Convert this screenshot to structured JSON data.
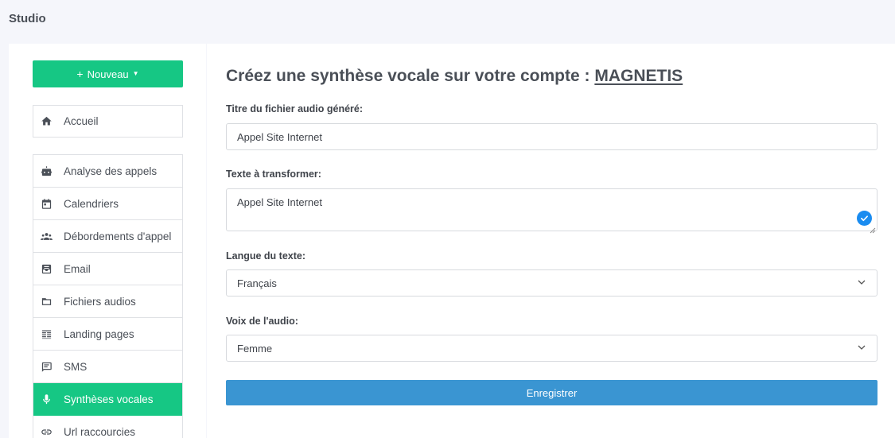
{
  "app": {
    "title": "Studio"
  },
  "sidebar": {
    "new_button": {
      "label": "Nouveau"
    },
    "home": {
      "label": "Accueil",
      "icon": "home-icon"
    },
    "items": [
      {
        "label": "Analyse des appels",
        "icon": "robot-icon",
        "active": false
      },
      {
        "label": "Calendriers",
        "icon": "calendar-icon",
        "active": false
      },
      {
        "label": "Débordements d'appel",
        "icon": "group-icon",
        "active": false
      },
      {
        "label": "Email",
        "icon": "email-icon",
        "active": false
      },
      {
        "label": "Fichiers audios",
        "icon": "folder-icon",
        "active": false
      },
      {
        "label": "Landing pages",
        "icon": "landing-page-icon",
        "active": false
      },
      {
        "label": "SMS",
        "icon": "sms-icon",
        "active": false
      },
      {
        "label": "Synthèses vocales",
        "icon": "microphone-icon",
        "active": true
      },
      {
        "label": "Url raccourcies",
        "icon": "link-icon",
        "active": false
      }
    ]
  },
  "main": {
    "heading_prefix": "Créez une synthèse vocale sur votre compte :",
    "account_name": "MAGNETIS",
    "title_field": {
      "label": "Titre du fichier audio généré:",
      "value": "Appel Site Internet"
    },
    "text_field": {
      "label": "Texte à transformer:",
      "value": "Appel Site Internet"
    },
    "language_field": {
      "label": "Langue du texte:",
      "value": "Français"
    },
    "voice_field": {
      "label": "Voix de l'audio:",
      "value": "Femme"
    },
    "save_label": "Enregistrer"
  },
  "colors": {
    "accent_green": "#16c784",
    "primary_blue": "#3a95d2",
    "check_blue": "#1a8cf0",
    "background": "#f5f6fb"
  }
}
